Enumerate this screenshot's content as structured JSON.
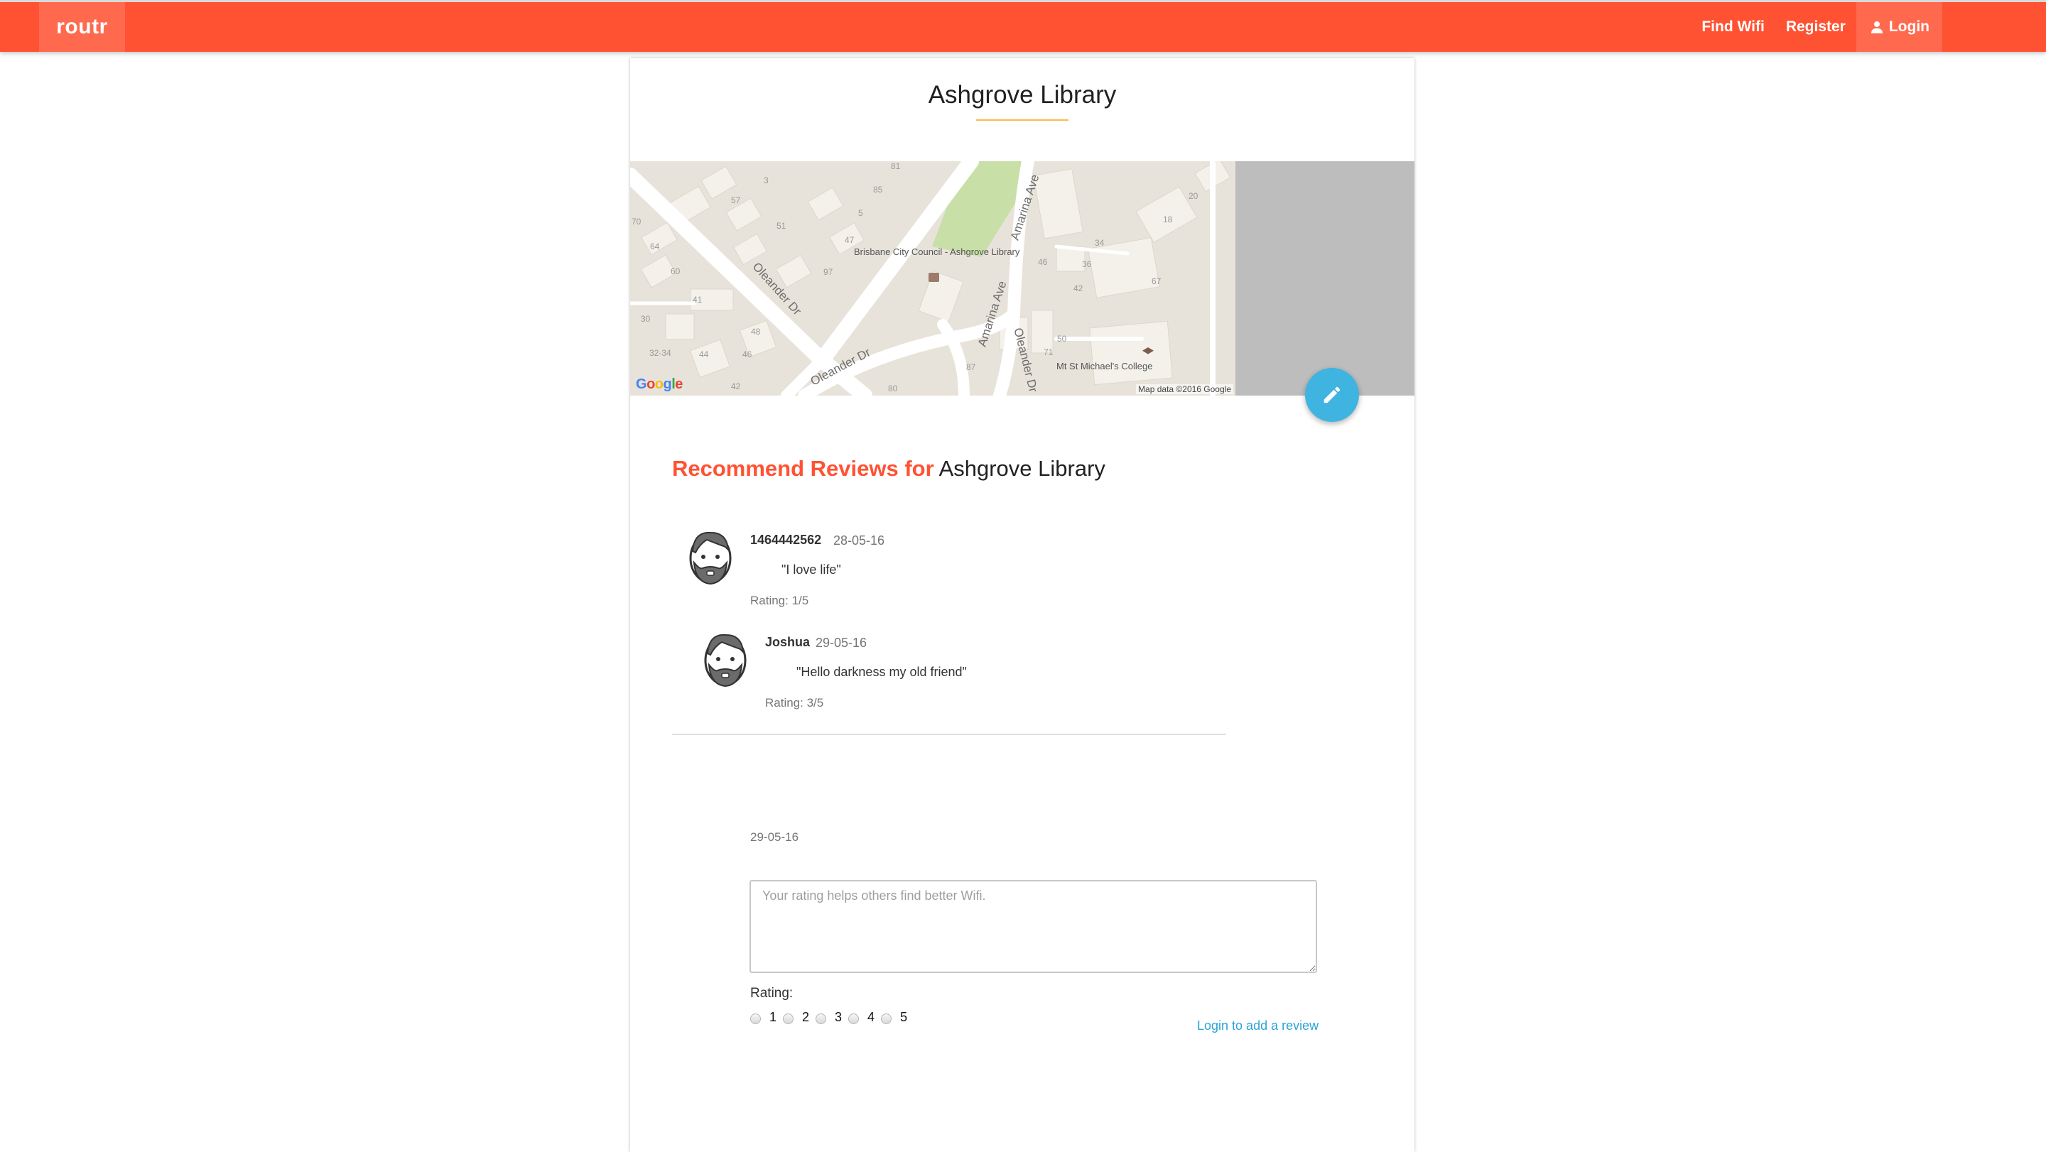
{
  "navbar": {
    "brand": "routr",
    "links": {
      "find_wifi": "Find Wifi",
      "register": "Register",
      "login": "Login"
    },
    "color": "#ff5233"
  },
  "place": {
    "title": "Ashgrove Library"
  },
  "map": {
    "streets": [
      "Oleander Dr",
      "Oleander Dr",
      "Amarina Ave",
      "Amarina Ave",
      "Oleander Dr"
    ],
    "lot_numbers": [
      "81",
      "3",
      "85",
      "57",
      "5",
      "51",
      "70",
      "47",
      "64",
      "97",
      "60",
      "41",
      "30",
      "48",
      "32-34",
      "44",
      "46",
      "42",
      "80",
      "20",
      "18",
      "34",
      "46",
      "36",
      "42",
      "67",
      "50",
      "71",
      "87"
    ],
    "pois": {
      "library": "Brisbane City Council - Ashgrove Library",
      "college": "Mt St Michael's College"
    },
    "logo": "Google",
    "credit": "Map data ©2016 Google"
  },
  "reviews": {
    "heading_accent": "Recommend Reviews for",
    "heading_place": "Ashgrove Library",
    "items": [
      {
        "author": "1464442562",
        "date": "28-05-16",
        "text": "\"I love life\"",
        "rating": "Rating: 1/5",
        "avatar": "bearded-man-avatar"
      },
      {
        "author": "Joshua",
        "date": "29-05-16",
        "text": "\"Hello darkness my old friend\"",
        "rating": "Rating: 3/5",
        "avatar": "bearded-man-avatar"
      }
    ]
  },
  "form": {
    "date": "29-05-16",
    "placeholder": "Your rating helps others find better Wifi.",
    "rating_label": "Rating:",
    "rating_options": [
      "1",
      "2",
      "3",
      "4",
      "5"
    ],
    "login_link": "Login to add a review"
  },
  "colors": {
    "accent": "#ff5233",
    "fab": "#40b4e0",
    "link": "#2ca3d6",
    "title_underline": "#ffb74d"
  }
}
